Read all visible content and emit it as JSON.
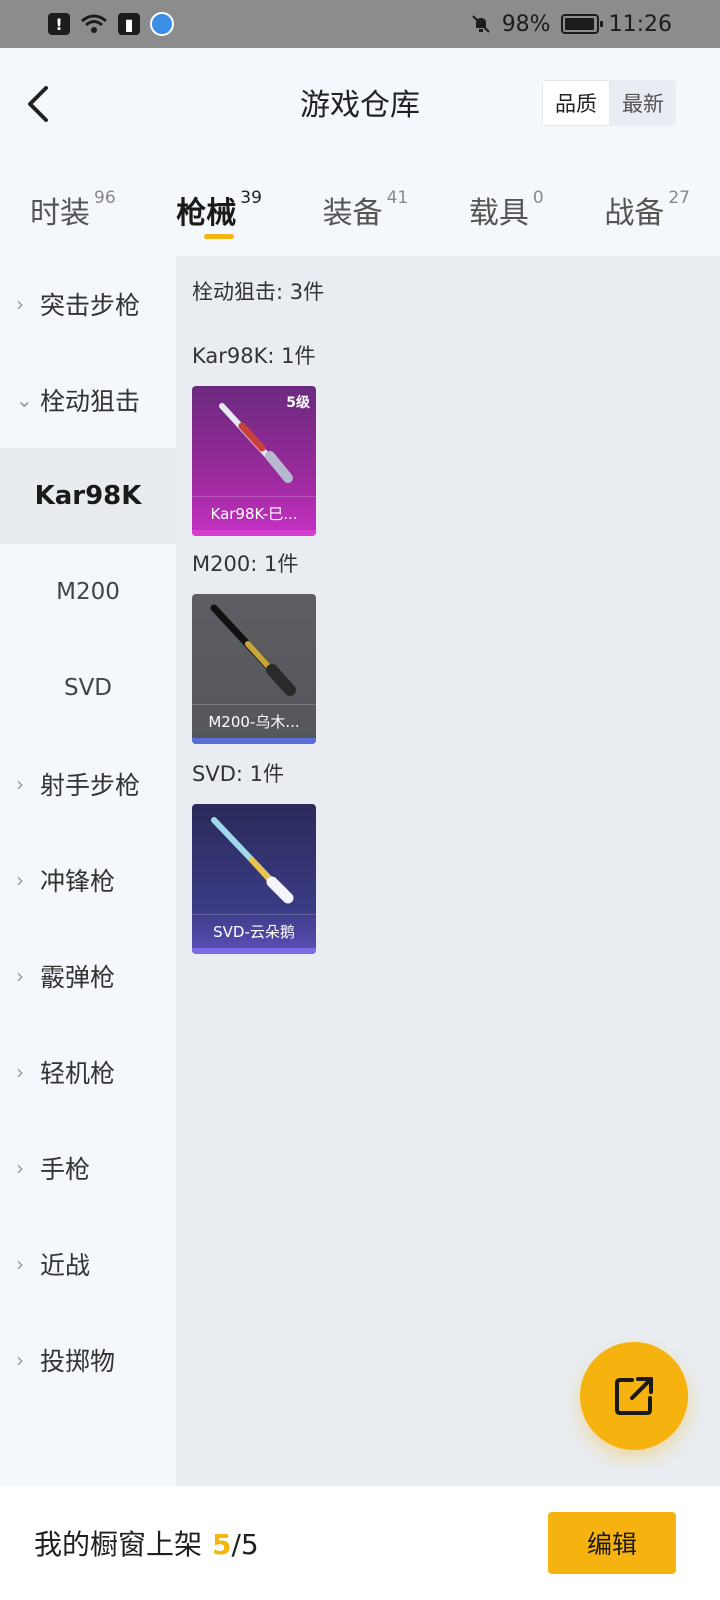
{
  "status_bar": {
    "battery": "98%",
    "battery_level": 0.98,
    "time": "11:26"
  },
  "header": {
    "title": "游戏仓库",
    "sort_options": [
      "品质",
      "最新"
    ],
    "sort_active": "品质"
  },
  "tabs": [
    {
      "label": "时装",
      "count": "96"
    },
    {
      "label": "枪械",
      "count": "39"
    },
    {
      "label": "装备",
      "count": "41"
    },
    {
      "label": "载具",
      "count": "0"
    },
    {
      "label": "战备",
      "count": "27"
    }
  ],
  "sidebar": {
    "items": [
      {
        "label": "突击步枪"
      },
      {
        "label": "栓动狙击"
      },
      {
        "label": "Kar98K"
      },
      {
        "label": "M200"
      },
      {
        "label": "SVD"
      },
      {
        "label": "射手步枪"
      },
      {
        "label": "冲锋枪"
      },
      {
        "label": "霰弹枪"
      },
      {
        "label": "轻机枪"
      },
      {
        "label": "手枪"
      },
      {
        "label": "近战"
      },
      {
        "label": "投掷物"
      }
    ]
  },
  "content": {
    "group_title": "栓动狙击: 3件",
    "sections": [
      {
        "title": "Kar98K: 1件",
        "card": {
          "name": "Kar98K-巳...",
          "level": "5级"
        }
      },
      {
        "title": "M200: 1件",
        "card": {
          "name": "M200-乌木..."
        }
      },
      {
        "title": "SVD: 1件",
        "card": {
          "name": "SVD-云朵鹅"
        }
      }
    ]
  },
  "bottom_bar": {
    "label": "我的橱窗上架",
    "count": "5",
    "total": "/5",
    "edit_label": "编辑"
  },
  "colors": {
    "accent": "#f6b20f",
    "purple_card": "#c531c3",
    "gray_card_bar": "#5b6ed6",
    "violet_card_bar": "#7a6be6"
  }
}
